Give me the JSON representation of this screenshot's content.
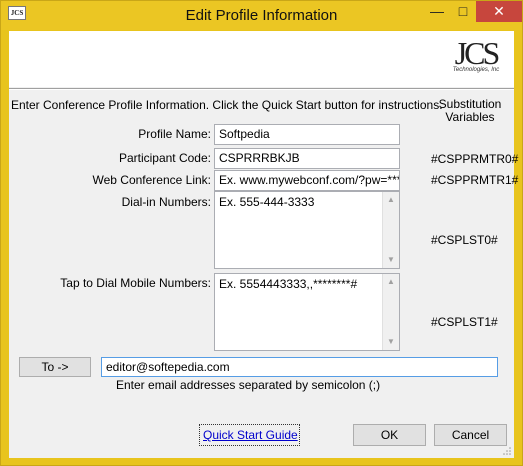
{
  "window": {
    "title": "Edit Profile Information",
    "icon_text": "JCS",
    "minimize_icon": "minimize-icon",
    "maximize_icon": "maximize-icon",
    "close_icon": "close-icon"
  },
  "logo": {
    "main": "JCS",
    "sub": "Technologies, Inc"
  },
  "intro": "Enter Conference Profile Information. Click the Quick Start button for instructions.",
  "substitution_header": "Substitution Variables",
  "fields": {
    "profile_name": {
      "label": "Profile Name:",
      "value": "Softpedia"
    },
    "participant_code": {
      "label": "Participant Code:",
      "value": "CSPRRRBKJB",
      "var": "#CSPPRMTR0#"
    },
    "web_conf_link": {
      "label": "Web Conference Link:",
      "value": "Ex. www.mywebconf.com/?pw=********",
      "var": "#CSPPRMTR1#"
    },
    "dial_in": {
      "label": "Dial-in Numbers:",
      "value": "Ex. 555-444-3333",
      "var": "#CSPLST0#"
    },
    "tap_to_dial": {
      "label": "Tap to Dial Mobile Numbers:",
      "value": "Ex. 5554443333,,********#",
      "var": "#CSPLST1#"
    }
  },
  "to": {
    "button": "To ->",
    "value": "editor@softepedia.com",
    "hint": "Enter email addresses separated by semicolon (;)"
  },
  "footer": {
    "quick_start": "Quick Start Guide",
    "ok": "OK",
    "cancel": "Cancel"
  }
}
